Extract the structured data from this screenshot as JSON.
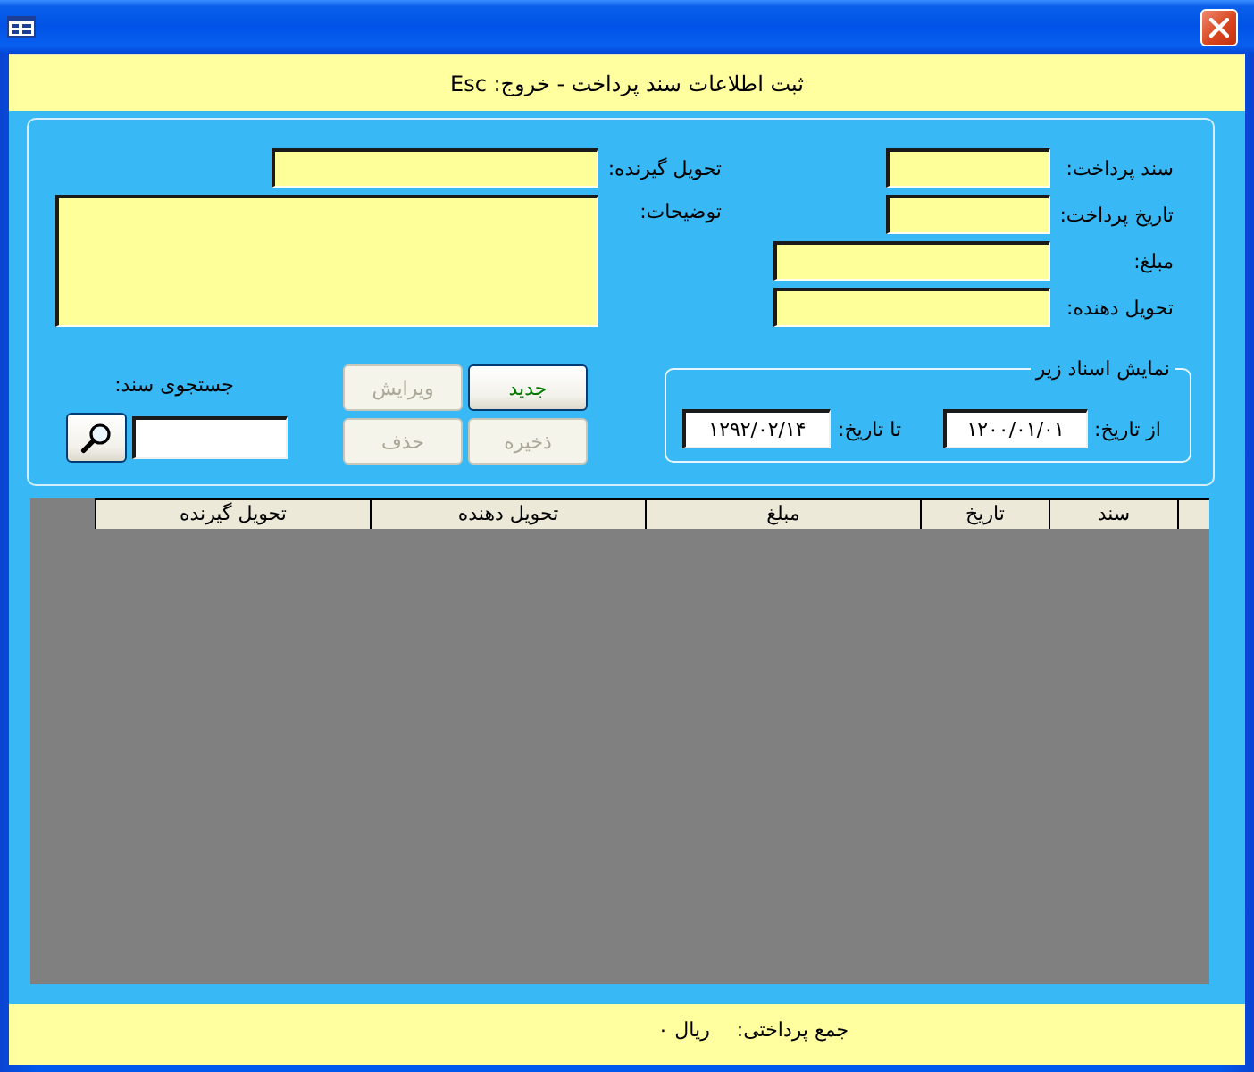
{
  "header": {
    "title": "ثبت اطلاعات سند پرداخت - خروج: Esc"
  },
  "fields_right": [
    {
      "label": "سند پرداخت:",
      "kind": "short"
    },
    {
      "label": "تاریخ پرداخت:",
      "kind": "short"
    },
    {
      "label": "مبلغ:",
      "kind": "long"
    },
    {
      "label": "تحویل دهنده:",
      "kind": "long"
    }
  ],
  "fields_left": [
    {
      "label": "تحویل گیرنده:",
      "kind": "line"
    },
    {
      "label": "توضیحات:",
      "kind": "multiline"
    }
  ],
  "date_filter": {
    "title": "نمایش اسناد زیر",
    "from": {
      "label": "از تاریخ:",
      "value": "۱۲۰۰/۰۱/۰۱"
    },
    "to": {
      "label": "تا تاریخ:",
      "value": "۱۲۹۲/۰۲/۱۴"
    }
  },
  "buttons": [
    {
      "label": "جدید",
      "disabled": false
    },
    {
      "label": "ویرایش",
      "disabled": true
    },
    {
      "label": "ذخیره",
      "disabled": true
    },
    {
      "label": "حذف",
      "disabled": true
    }
  ],
  "search": {
    "label": "جستجوی سند:"
  },
  "table": {
    "columns": [
      "سند",
      "تاریخ",
      "مبلغ",
      "تحویل دهنده",
      "تحویل گیرنده"
    ]
  },
  "footer": {
    "total_label": "جمع پرداختی:",
    "total_value": "ریال ۰"
  }
}
